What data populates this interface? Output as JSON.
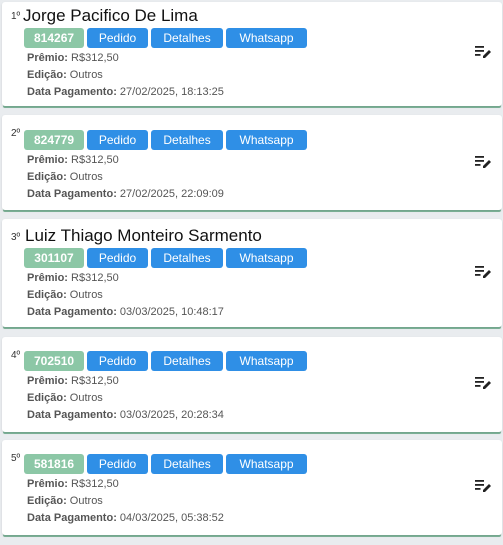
{
  "entries": [
    {
      "rank": "1º",
      "name": "Jorge Pacifico De Lima",
      "code": "814267",
      "buttons": {
        "pedido": "Pedido",
        "detalhes": "Detalhes",
        "whatsapp": "Whatsapp"
      },
      "premio_label": "Prêmio:",
      "premio": "R$312,50",
      "edicao_label": "Edição:",
      "edicao": "Outros",
      "data_label": "Data Pagamento:",
      "data": "27/02/2025, 18:13:25"
    },
    {
      "rank": "2º",
      "name": "",
      "code": "824779",
      "buttons": {
        "pedido": "Pedido",
        "detalhes": "Detalhes",
        "whatsapp": "Whatsapp"
      },
      "premio_label": "Prêmio:",
      "premio": "R$312,50",
      "edicao_label": "Edição:",
      "edicao": "Outros",
      "data_label": "Data Pagamento:",
      "data": "27/02/2025, 22:09:09"
    },
    {
      "rank": "3º",
      "name": "Luiz Thiago Monteiro Sarmento",
      "code": "301107",
      "buttons": {
        "pedido": "Pedido",
        "detalhes": "Detalhes",
        "whatsapp": "Whatsapp"
      },
      "premio_label": "Prêmio:",
      "premio": "R$312,50",
      "edicao_label": "Edição:",
      "edicao": "Outros",
      "data_label": "Data Pagamento:",
      "data": "03/03/2025, 10:48:17"
    },
    {
      "rank": "4º",
      "name": "",
      "code": "702510",
      "buttons": {
        "pedido": "Pedido",
        "detalhes": "Detalhes",
        "whatsapp": "Whatsapp"
      },
      "premio_label": "Prêmio:",
      "premio": "R$312,50",
      "edicao_label": "Edição:",
      "edicao": "Outros",
      "data_label": "Data Pagamento:",
      "data": "03/03/2025, 20:28:34"
    },
    {
      "rank": "5º",
      "name": "",
      "code": "581816",
      "buttons": {
        "pedido": "Pedido",
        "detalhes": "Detalhes",
        "whatsapp": "Whatsapp"
      },
      "premio_label": "Prêmio:",
      "premio": "R$312,50",
      "edicao_label": "Edição:",
      "edicao": "Outros",
      "data_label": "Data Pagamento:",
      "data": "04/03/2025, 05:38:52"
    }
  ],
  "icons": {
    "edit": "edit-list-icon"
  },
  "colors": {
    "code_badge": "#8cc7a6",
    "button": "#2f8fe6",
    "accent_border": "#7fb59a"
  }
}
